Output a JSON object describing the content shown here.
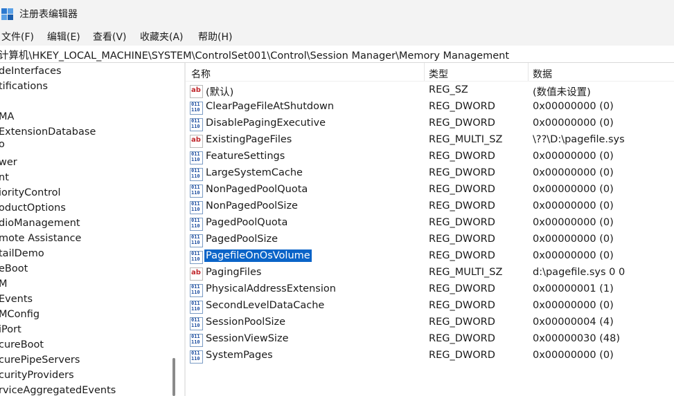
{
  "window": {
    "title": "注册表编辑器",
    "icon": "registry-editor-icon"
  },
  "menu": [
    {
      "label": "文件(F)"
    },
    {
      "label": "编辑(E)"
    },
    {
      "label": "查看(V)"
    },
    {
      "label": "收藏夹(A)"
    },
    {
      "label": "帮助(H)"
    }
  ],
  "address": {
    "path": "计算机\\HKEY_LOCAL_MACHINE\\SYSTEM\\ControlSet001\\Control\\Session Manager\\Memory Management"
  },
  "tree": {
    "items": [
      {
        "label": "deInterfaces"
      },
      {
        "label": "tifications"
      },
      {
        "label": ""
      },
      {
        "label": "MA"
      },
      {
        "label": "ExtensionDatabase"
      },
      {
        "label": "o"
      },
      {
        "label": "wer"
      },
      {
        "label": "nt"
      },
      {
        "label": "iorityControl"
      },
      {
        "label": "oductOptions"
      },
      {
        "label": "dioManagement"
      },
      {
        "label": "mote Assistance"
      },
      {
        "label": "tailDemo"
      },
      {
        "label": "eBoot"
      },
      {
        "label": "M"
      },
      {
        "label": "Events"
      },
      {
        "label": "MConfig"
      },
      {
        "label": "iPort"
      },
      {
        "label": "cureBoot"
      },
      {
        "label": "curePipeServers"
      },
      {
        "label": "curityProviders"
      },
      {
        "label": "rviceAggregatedEvents"
      }
    ]
  },
  "list": {
    "columns": {
      "name": "名称",
      "type": "类型",
      "data": "数据"
    },
    "rows": [
      {
        "name": "(默认)",
        "type": "REG_SZ",
        "data": "(数值未设置)",
        "icon": "string-value-icon",
        "selected": false
      },
      {
        "name": "ClearPageFileAtShutdown",
        "type": "REG_DWORD",
        "data": "0x00000000 (0)",
        "icon": "binary-value-icon",
        "selected": false
      },
      {
        "name": "DisablePagingExecutive",
        "type": "REG_DWORD",
        "data": "0x00000000 (0)",
        "icon": "binary-value-icon",
        "selected": false
      },
      {
        "name": "ExistingPageFiles",
        "type": "REG_MULTI_SZ",
        "data": "\\??\\D:\\pagefile.sys",
        "icon": "string-value-icon",
        "selected": false
      },
      {
        "name": "FeatureSettings",
        "type": "REG_DWORD",
        "data": "0x00000000 (0)",
        "icon": "binary-value-icon",
        "selected": false
      },
      {
        "name": "LargeSystemCache",
        "type": "REG_DWORD",
        "data": "0x00000000 (0)",
        "icon": "binary-value-icon",
        "selected": false
      },
      {
        "name": "NonPagedPoolQuota",
        "type": "REG_DWORD",
        "data": "0x00000000 (0)",
        "icon": "binary-value-icon",
        "selected": false
      },
      {
        "name": "NonPagedPoolSize",
        "type": "REG_DWORD",
        "data": "0x00000000 (0)",
        "icon": "binary-value-icon",
        "selected": false
      },
      {
        "name": "PagedPoolQuota",
        "type": "REG_DWORD",
        "data": "0x00000000 (0)",
        "icon": "binary-value-icon",
        "selected": false
      },
      {
        "name": "PagedPoolSize",
        "type": "REG_DWORD",
        "data": "0x00000000 (0)",
        "icon": "binary-value-icon",
        "selected": false
      },
      {
        "name": "PagefileOnOsVolume",
        "type": "REG_DWORD",
        "data": "0x00000000 (0)",
        "icon": "binary-value-icon",
        "selected": true
      },
      {
        "name": "PagingFiles",
        "type": "REG_MULTI_SZ",
        "data": "d:\\pagefile.sys 0 0",
        "icon": "string-value-icon",
        "selected": false
      },
      {
        "name": "PhysicalAddressExtension",
        "type": "REG_DWORD",
        "data": "0x00000001 (1)",
        "icon": "binary-value-icon",
        "selected": false
      },
      {
        "name": "SecondLevelDataCache",
        "type": "REG_DWORD",
        "data": "0x00000000 (0)",
        "icon": "binary-value-icon",
        "selected": false
      },
      {
        "name": "SessionPoolSize",
        "type": "REG_DWORD",
        "data": "0x00000004 (4)",
        "icon": "binary-value-icon",
        "selected": false
      },
      {
        "name": "SessionViewSize",
        "type": "REG_DWORD",
        "data": "0x00000030 (48)",
        "icon": "binary-value-icon",
        "selected": false
      },
      {
        "name": "SystemPages",
        "type": "REG_DWORD",
        "data": "0x00000000 (0)",
        "icon": "binary-value-icon",
        "selected": false
      }
    ]
  },
  "colors": {
    "selection": "#0a64c8",
    "chrome": "#f3f3f3"
  }
}
